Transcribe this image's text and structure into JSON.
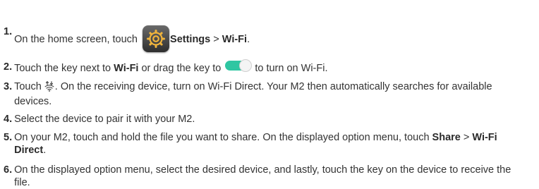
{
  "steps": [
    {
      "num": "1.",
      "parts": {
        "a": "On the home screen, touch",
        "settings": "Settings",
        "sep": " > ",
        "wifi": "Wi-Fi",
        "end": "."
      },
      "icon": "settings-gear-icon"
    },
    {
      "num": "2.",
      "parts": {
        "a": "Touch the key next to ",
        "wifi": "Wi-Fi",
        "b": " or drag the key to",
        "c": "to turn on Wi-Fi."
      },
      "icon": "toggle-switch-on-icon",
      "accent": "#2fc6a2"
    },
    {
      "num": "3.",
      "parts": {
        "a": "Touch",
        "b": ". On the receiving device, turn on Wi-Fi Direct. Your M2 then automatically searches for available devices."
      },
      "icon": "wifi-direct-icon"
    },
    {
      "num": "4.",
      "parts": {
        "a": "Select the device to pair it with your M2."
      }
    },
    {
      "num": "5.",
      "parts": {
        "a": "On your M2, touch and hold the file you want to share. On the displayed option menu, touch ",
        "share": "Share",
        "sep": " > ",
        "wfd": "Wi-Fi Direct",
        "end": "."
      }
    },
    {
      "num": "6.",
      "parts": {
        "a": "On the displayed option menu, select the desired device, and lastly, touch the key on the device to receive the file."
      }
    }
  ]
}
